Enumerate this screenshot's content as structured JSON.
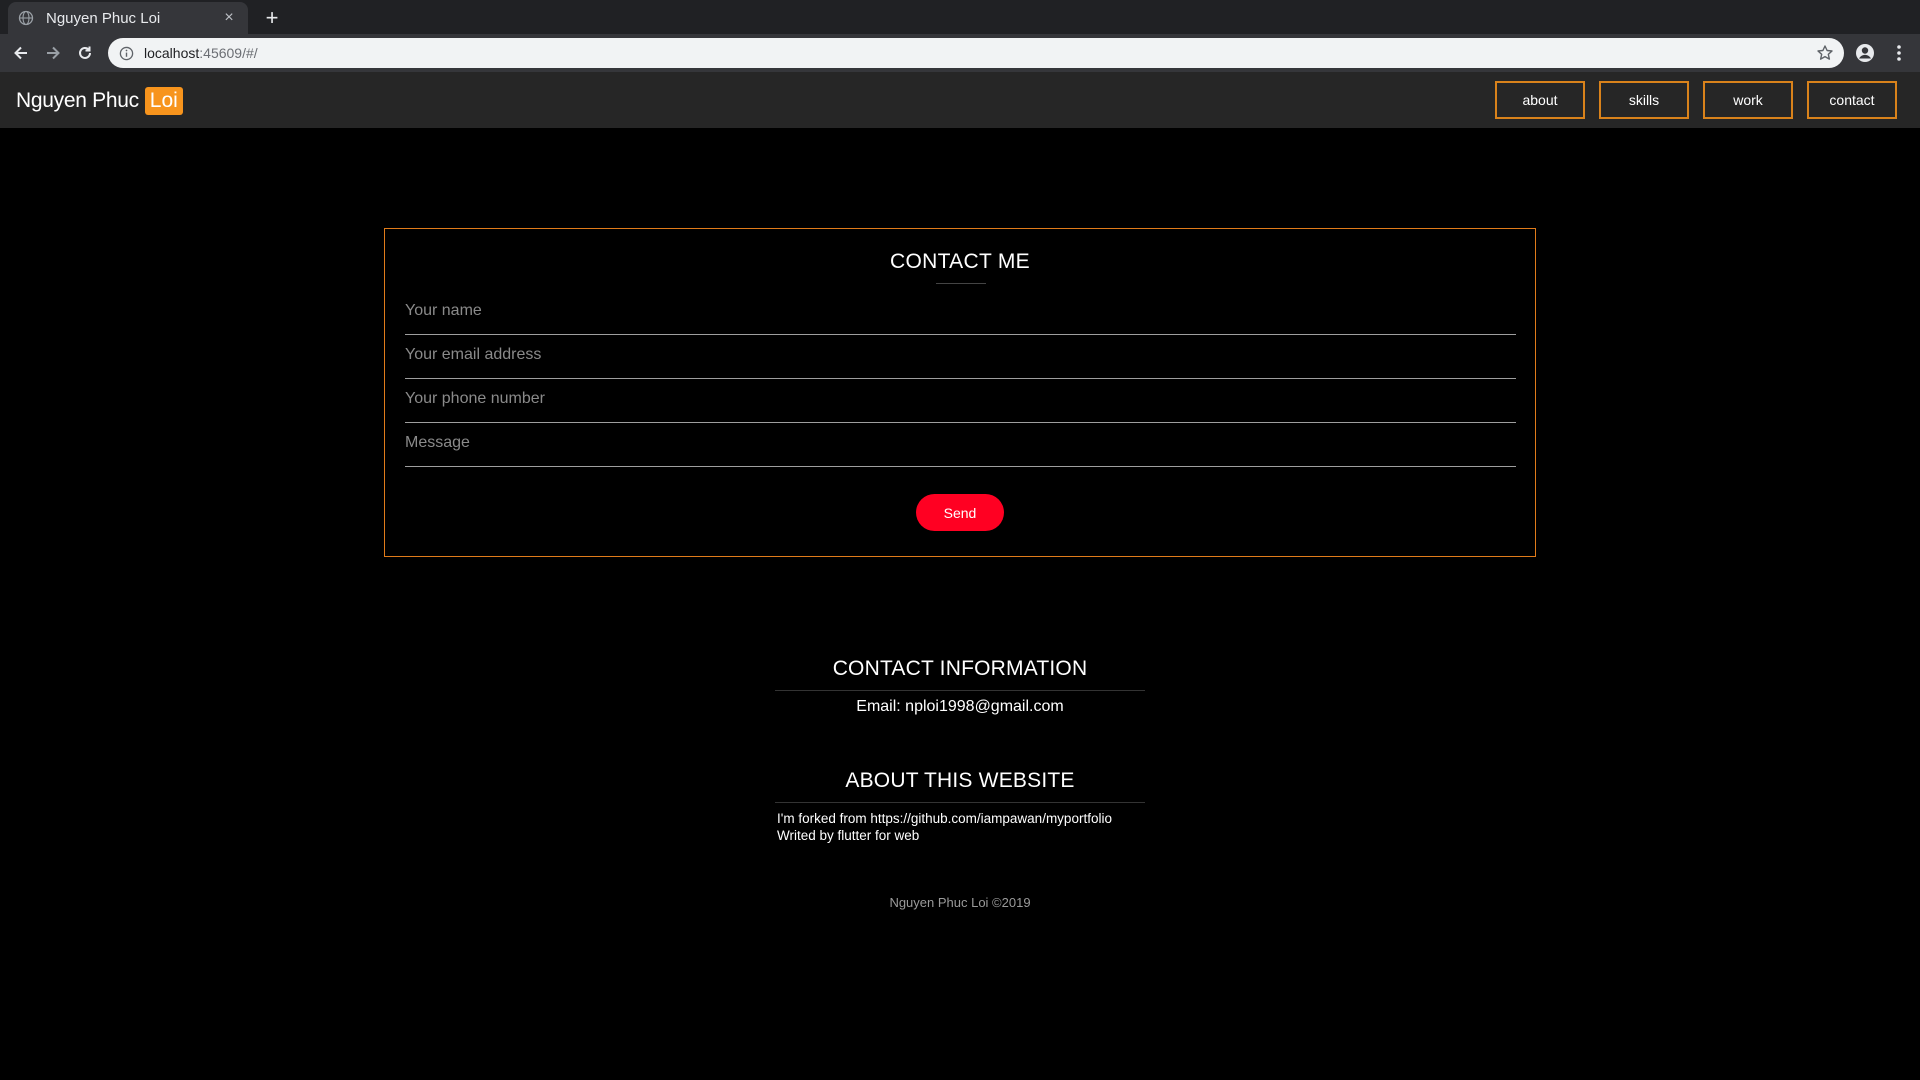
{
  "browser": {
    "tab_title": "Nguyen Phuc Loi",
    "tab_close": "×",
    "new_tab": "+",
    "url_host": "localhost",
    "url_rest": ":45609/#/"
  },
  "header": {
    "brand_name": "Nguyen Phuc",
    "brand_highlight": "Loi",
    "nav": [
      "about",
      "skills",
      "work",
      "contact"
    ]
  },
  "contact_form": {
    "title": "CONTACT ME",
    "fields": [
      {
        "placeholder": "Your name"
      },
      {
        "placeholder": "Your email address"
      },
      {
        "placeholder": "Your phone number"
      },
      {
        "placeholder": "Message"
      }
    ],
    "send_label": "Send"
  },
  "contact_info": {
    "title": "CONTACT INFORMATION",
    "email_line": "Email: nploi1998@gmail.com"
  },
  "about_site": {
    "title": "ABOUT THIS WEBSITE",
    "line1": "I'm forked from https://github.com/iampawan/myportfolio",
    "line2": "Writed by flutter for web"
  },
  "footer": {
    "copyright": "Nguyen Phuc Loi ©2019"
  },
  "colors": {
    "accent_orange": "#f7941d",
    "send_red": "#ff0022"
  },
  "icons": [
    "globe-icon",
    "close-icon",
    "plus-icon",
    "back-arrow-icon",
    "forward-arrow-icon",
    "reload-icon",
    "info-icon",
    "star-icon",
    "account-icon",
    "more-vert-icon"
  ]
}
